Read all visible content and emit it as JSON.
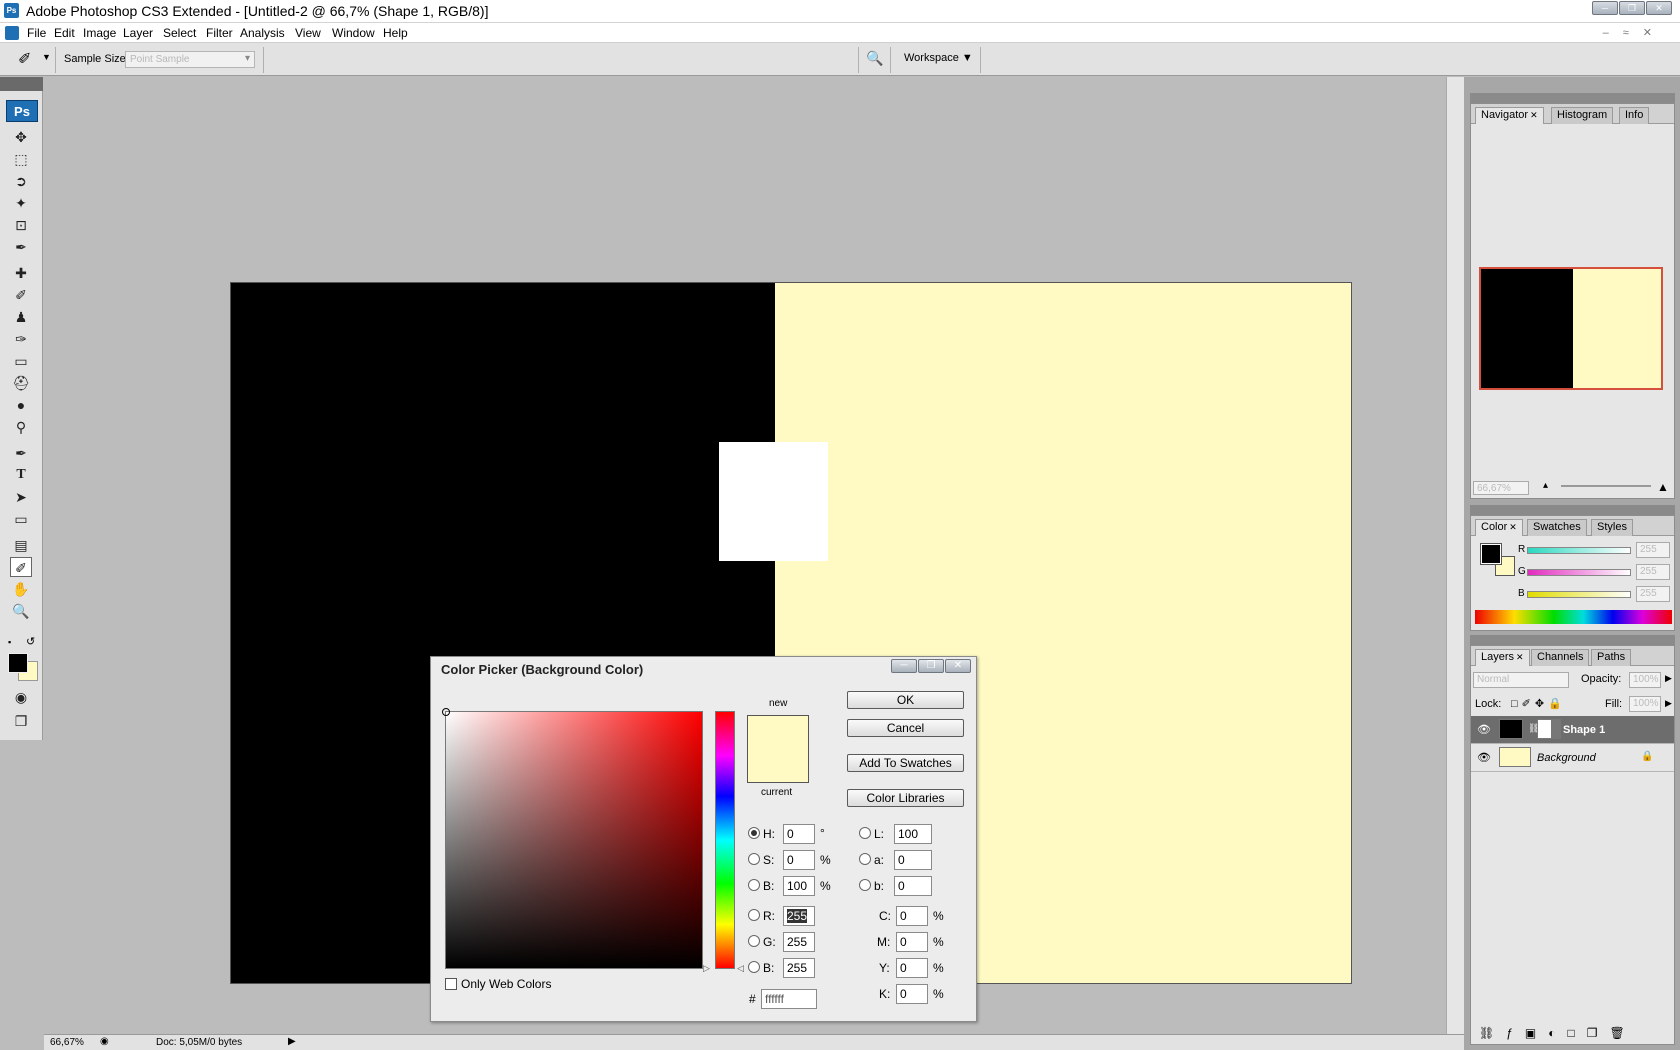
{
  "window": {
    "title": "Adobe Photoshop CS3 Extended - [Untitled-2 @ 66,7% (Shape 1, RGB/8)]",
    "app_icon": "Ps"
  },
  "menu": [
    "File",
    "Edit",
    "Image",
    "Layer",
    "Select",
    "Filter",
    "Analysis",
    "View",
    "Window",
    "Help"
  ],
  "options": {
    "sample_size_label": "Sample Size:",
    "sample_size_value": "Point Sample",
    "workspace_label": "Workspace"
  },
  "toolbox": {
    "logo": "Ps"
  },
  "status": {
    "zoom": "66,67%",
    "doc": "Doc: 5,05M/0 bytes"
  },
  "panels": {
    "top_tabs": [
      "Navigator",
      "Histogram",
      "Info"
    ],
    "nav_zoom": "66,67%",
    "color_tabs": [
      "Color",
      "Swatches",
      "Styles"
    ],
    "color_labels": [
      "R",
      "G",
      "B"
    ],
    "color_values": [
      "255",
      "255",
      "255"
    ],
    "layers_tabs": [
      "Layers",
      "Channels",
      "Paths"
    ],
    "blend_mode": "Normal",
    "opacity_label": "Opacity:",
    "opacity_value": "100%",
    "lock_label": "Lock:",
    "fill_label": "Fill:",
    "fill_value": "100%",
    "layers": [
      "Shape 1",
      "Background"
    ]
  },
  "picker": {
    "title": "Color Picker (Background Color)",
    "new_label": "new",
    "current_label": "current",
    "buttons": [
      "OK",
      "Cancel",
      "Add To Swatches",
      "Color Libraries"
    ],
    "hsb": [
      {
        "label": "H:",
        "value": "0",
        "unit": "°"
      },
      {
        "label": "S:",
        "value": "0",
        "unit": "%"
      },
      {
        "label": "B:",
        "value": "100",
        "unit": "%"
      }
    ],
    "lab": [
      {
        "label": "L:",
        "value": "100"
      },
      {
        "label": "a:",
        "value": "0"
      },
      {
        "label": "b:",
        "value": "0"
      }
    ],
    "rgb": [
      {
        "label": "R:",
        "value": "255"
      },
      {
        "label": "G:",
        "value": "255"
      },
      {
        "label": "B:",
        "value": "255"
      }
    ],
    "cmyk": [
      {
        "label": "C:",
        "value": "0",
        "unit": "%"
      },
      {
        "label": "M:",
        "value": "0",
        "unit": "%"
      },
      {
        "label": "Y:",
        "value": "0",
        "unit": "%"
      },
      {
        "label": "K:",
        "value": "0",
        "unit": "%"
      }
    ],
    "web_colors_label": "Only Web Colors",
    "hex_label": "#",
    "hex_value": "ffffff"
  },
  "colors": {
    "cream": "#fffac4",
    "accent": "#d4503c"
  }
}
